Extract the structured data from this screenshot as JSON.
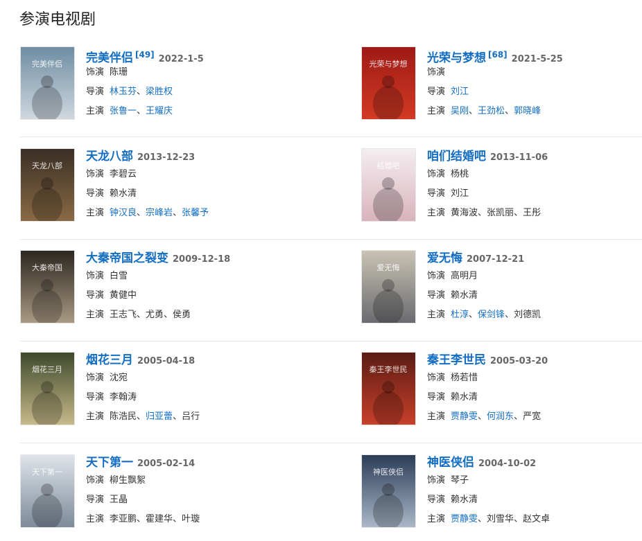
{
  "section": {
    "title": "参演电视剧"
  },
  "dramas": [
    {
      "title": "完美伴侣",
      "ref": "[49]",
      "date": "2022-1-5",
      "role_label": "饰演",
      "role": "陈珊",
      "director_label": "导演",
      "directors": [
        {
          "name": "林玉芬",
          "link": true
        },
        {
          "name": "梁胜权",
          "link": true
        }
      ],
      "cast_label": "主演",
      "cast": [
        {
          "name": "张鲁一",
          "link": true
        },
        {
          "name": "王耀庆",
          "link": true
        }
      ],
      "poster_colors": [
        "#6f8da3",
        "#cfd8df"
      ],
      "poster_text": "完美伴侣"
    },
    {
      "title": "光荣与梦想",
      "ref": "[68]",
      "date": "2021-5-25",
      "role_label": "饰演",
      "role": "",
      "director_label": "导演",
      "directors": [
        {
          "name": "刘江",
          "link": true
        }
      ],
      "cast_label": "主演",
      "cast": [
        {
          "name": "吴刚",
          "link": true
        },
        {
          "name": "王劲松",
          "link": true
        },
        {
          "name": "郭晓峰",
          "link": true
        }
      ],
      "poster_colors": [
        "#9e1a16",
        "#d23a24"
      ],
      "poster_text": "光荣与梦想"
    },
    {
      "title": "天龙八部",
      "ref": "",
      "date": "2013-12-23",
      "role_label": "饰演",
      "role": "李碧云",
      "director_label": "导演",
      "directors": [
        {
          "name": "赖水清",
          "link": false
        }
      ],
      "cast_label": "主演",
      "cast": [
        {
          "name": "钟汉良",
          "link": true
        },
        {
          "name": "宗峰岩",
          "link": true
        },
        {
          "name": "张馨予",
          "link": true
        }
      ],
      "poster_colors": [
        "#3a2f25",
        "#8a6a45"
      ],
      "poster_text": "天龙八部"
    },
    {
      "title": "咱们结婚吧",
      "ref": "",
      "date": "2013-11-06",
      "role_label": "饰演",
      "role": "杨桃",
      "director_label": "导演",
      "directors": [
        {
          "name": "刘江",
          "link": false
        }
      ],
      "cast_label": "主演",
      "cast": [
        {
          "name": "黄海波",
          "link": false
        },
        {
          "name": "张凯丽",
          "link": false
        },
        {
          "name": "王彤",
          "link": false
        }
      ],
      "poster_colors": [
        "#f4eef0",
        "#d9b3bd"
      ],
      "poster_text": "结婚吧"
    },
    {
      "title": "大秦帝国之裂变",
      "ref": "",
      "date": "2009-12-18",
      "role_label": "饰演",
      "role": "白雪",
      "director_label": "导演",
      "directors": [
        {
          "name": "黄健中",
          "link": false
        }
      ],
      "cast_label": "主演",
      "cast": [
        {
          "name": "王志飞",
          "link": false
        },
        {
          "name": "尤勇",
          "link": false
        },
        {
          "name": "侯勇",
          "link": false
        }
      ],
      "poster_colors": [
        "#2b2620",
        "#a99a82"
      ],
      "poster_text": "大秦帝国"
    },
    {
      "title": "爱无悔",
      "ref": "",
      "date": "2007-12-21",
      "role_label": "饰演",
      "role": "高明月",
      "director_label": "导演",
      "directors": [
        {
          "name": "赖水清",
          "link": false
        }
      ],
      "cast_label": "主演",
      "cast": [
        {
          "name": "杜淳",
          "link": true
        },
        {
          "name": "保剑锋",
          "link": true
        },
        {
          "name": "刘德凯",
          "link": false
        }
      ],
      "poster_colors": [
        "#c9c3b4",
        "#6a6b70"
      ],
      "poster_text": "爱无悔"
    },
    {
      "title": "烟花三月",
      "ref": "",
      "date": "2005-04-18",
      "role_label": "饰演",
      "role": "沈宛",
      "director_label": "导演",
      "directors": [
        {
          "name": "李翰涛",
          "link": false
        }
      ],
      "cast_label": "主演",
      "cast": [
        {
          "name": "陈浩民",
          "link": false
        },
        {
          "name": "归亚蕾",
          "link": true
        },
        {
          "name": "吕行",
          "link": false
        }
      ],
      "poster_colors": [
        "#3e4a2c",
        "#c7b98a"
      ],
      "poster_text": "烟花三月"
    },
    {
      "title": "秦王李世民",
      "ref": "",
      "date": "2005-03-20",
      "role_label": "饰演",
      "role": "杨若惜",
      "director_label": "导演",
      "directors": [
        {
          "name": "赖水清",
          "link": false
        }
      ],
      "cast_label": "主演",
      "cast": [
        {
          "name": "贾静雯",
          "link": true
        },
        {
          "name": "何润东",
          "link": true
        },
        {
          "name": "严宽",
          "link": false
        }
      ],
      "poster_colors": [
        "#5a1c14",
        "#c8402a"
      ],
      "poster_text": "秦王李世民"
    },
    {
      "title": "天下第一",
      "ref": "",
      "date": "2005-02-14",
      "role_label": "饰演",
      "role": "柳生飘絮",
      "director_label": "导演",
      "directors": [
        {
          "name": "王晶",
          "link": false
        }
      ],
      "cast_label": "主演",
      "cast": [
        {
          "name": "李亚鹏",
          "link": false
        },
        {
          "name": "霍建华",
          "link": false
        },
        {
          "name": "叶璇",
          "link": false
        }
      ],
      "poster_colors": [
        "#dfe4ea",
        "#7c8a99"
      ],
      "poster_text": "天下第一"
    },
    {
      "title": "神医侠侣",
      "ref": "",
      "date": "2004-10-02",
      "role_label": "饰演",
      "role": "琴子",
      "director_label": "导演",
      "directors": [
        {
          "name": "赖水清",
          "link": false
        }
      ],
      "cast_label": "主演",
      "cast": [
        {
          "name": "贾静雯",
          "link": true
        },
        {
          "name": "刘雪华",
          "link": false
        },
        {
          "name": "赵文卓",
          "link": false
        }
      ],
      "poster_colors": [
        "#2c3d57",
        "#a9b7c8"
      ],
      "poster_text": "神医侠侣"
    }
  ]
}
